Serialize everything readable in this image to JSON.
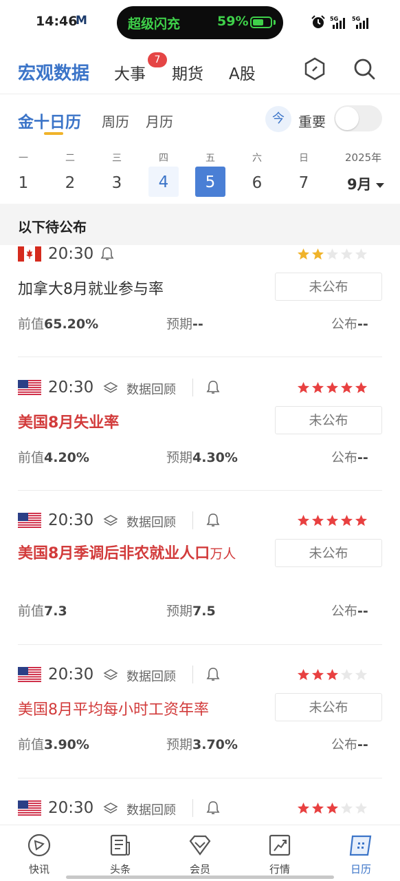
{
  "status_bar": {
    "time": "14:46",
    "app_badge": "M",
    "charge_label": "超级闪充",
    "battery_percent": "59%",
    "battery_level": 0.59
  },
  "header": {
    "title": "宏观数据",
    "tabs": [
      {
        "label": "大事",
        "badge": "7"
      },
      {
        "label": "期货"
      },
      {
        "label": "A股"
      }
    ],
    "icons": [
      "hexagon-icon",
      "search-icon"
    ]
  },
  "calendar_tabs": {
    "active": "金十日历",
    "others": [
      "周历",
      "月历"
    ],
    "today_label": "今",
    "important_label": "重要",
    "important_on": false
  },
  "week": {
    "weekdays": [
      "一",
      "二",
      "三",
      "四",
      "五",
      "六",
      "日"
    ],
    "dates": [
      "1",
      "2",
      "3",
      "4",
      "5",
      "6",
      "7"
    ],
    "selected_date": "4",
    "today_date": "5",
    "year": "2025年",
    "month": "9月"
  },
  "section_title": "以下待公布",
  "events": [
    {
      "country": "Canada",
      "time": "20:30",
      "review": "",
      "stars": 2,
      "name": "加拿大8月就业参与率",
      "unit": "",
      "highlight": false,
      "status": "未公布",
      "prev_label": "前值",
      "prev": "65.20%",
      "fore_label": "预期",
      "fore": "--",
      "pub_label": "公布",
      "pub": "--"
    },
    {
      "country": "USA",
      "time": "20:30",
      "review": "数据回顾",
      "stars": 5,
      "name": "美国8月失业率",
      "unit": "",
      "highlight": true,
      "status": "未公布",
      "prev_label": "前值",
      "prev": "4.20%",
      "fore_label": "预期",
      "fore": "4.30%",
      "pub_label": "公布",
      "pub": "--"
    },
    {
      "country": "USA",
      "time": "20:30",
      "review": "数据回顾",
      "stars": 5,
      "name": "美国8月季调后非农就业人口",
      "unit": "万人",
      "highlight": true,
      "status": "未公布",
      "prev_label": "前值",
      "prev": "7.3",
      "fore_label": "预期",
      "fore": "7.5",
      "pub_label": "公布",
      "pub": "--"
    },
    {
      "country": "USA",
      "time": "20:30",
      "review": "数据回顾",
      "stars": 3,
      "name": "美国8月平均每小时工资年率",
      "unit": "",
      "highlight": false,
      "status": "未公布",
      "prev_label": "前值",
      "prev": "3.90%",
      "fore_label": "预期",
      "fore": "3.70%",
      "pub_label": "公布",
      "pub": "--"
    },
    {
      "country": "USA",
      "time": "20:30",
      "review": "数据回顾",
      "stars": 3
    }
  ],
  "bottom_nav": [
    {
      "label": "快讯"
    },
    {
      "label": "头条"
    },
    {
      "label": "会员"
    },
    {
      "label": "行情"
    },
    {
      "label": "日历",
      "active": true
    }
  ],
  "colors": {
    "accent": "#3b74c8",
    "star_on": "#e84040",
    "star_mid": "#f0b32a",
    "highlight_red": "#d23b3b"
  }
}
